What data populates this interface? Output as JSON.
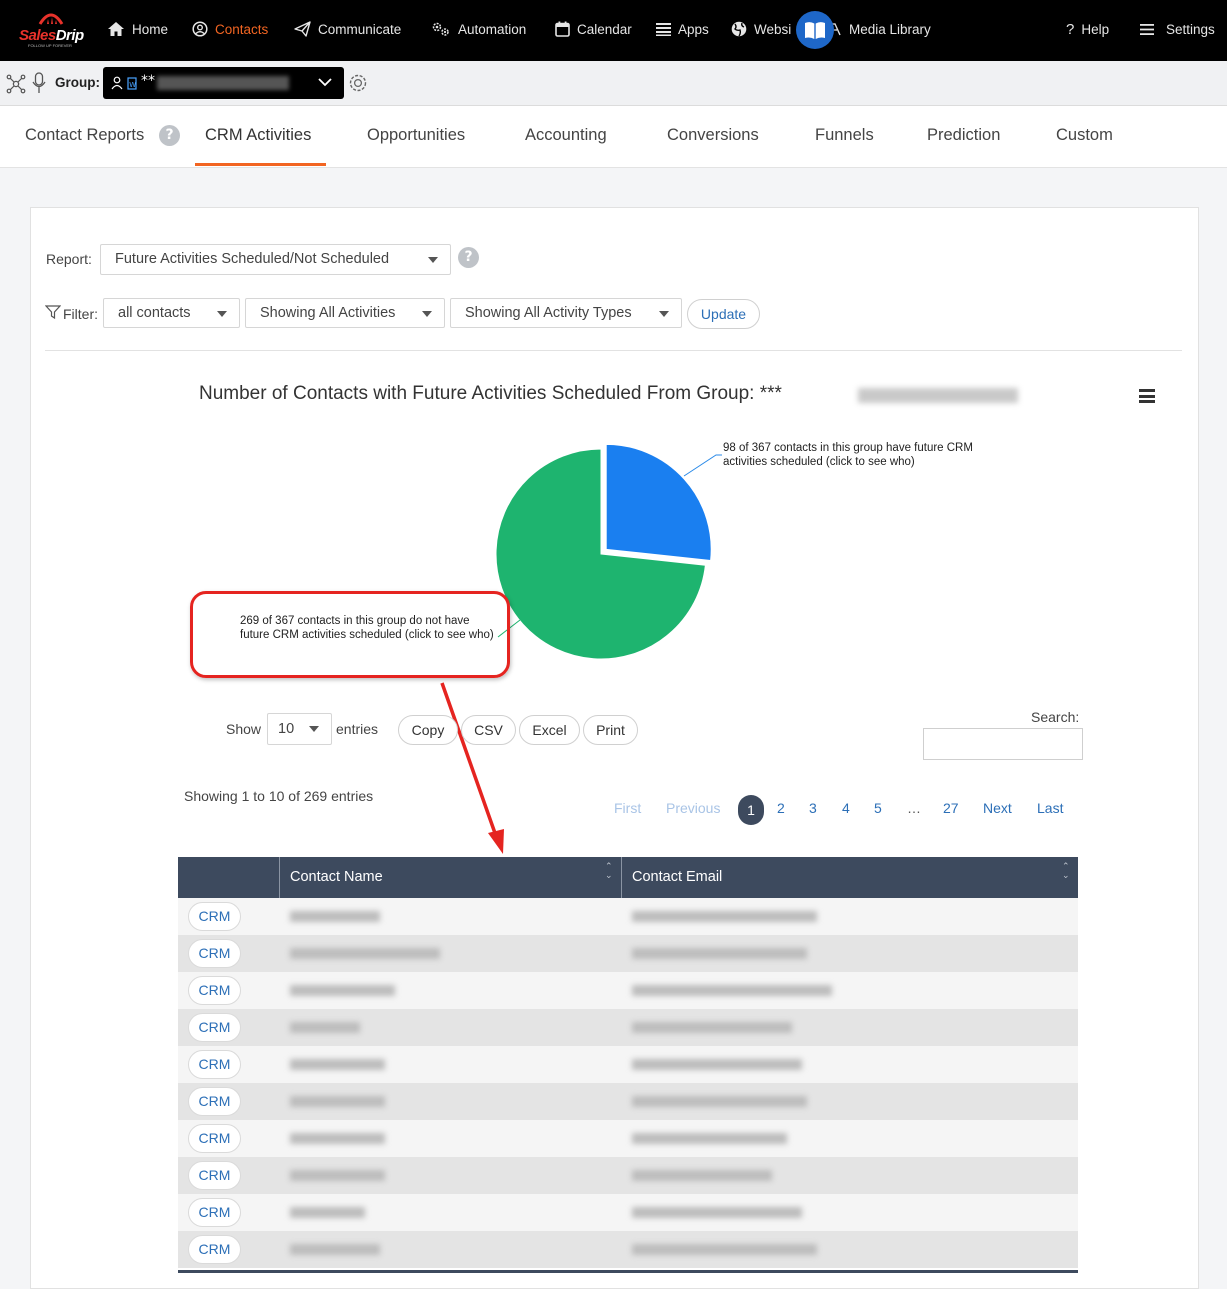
{
  "brand": {
    "name_red": "Sales",
    "name_white": "Drip",
    "tagline": "FOLLOW UP FOREVER"
  },
  "topnav": [
    {
      "label": "Home",
      "icon": "home-icon"
    },
    {
      "label": "Contacts",
      "icon": "user-circle-icon",
      "active": true
    },
    {
      "label": "Communicate",
      "icon": "paper-plane-icon"
    },
    {
      "label": "Automation",
      "icon": "gears-icon"
    },
    {
      "label": "Calendar",
      "icon": "calendar-icon"
    },
    {
      "label": "Apps",
      "icon": "list-icon"
    },
    {
      "label": "Websi",
      "icon": "globe-icon"
    },
    {
      "label": "Media Library",
      "icon": "media-icon"
    },
    {
      "label": "Help",
      "icon": "question-icon"
    },
    {
      "label": "Settings",
      "icon": "menu-icon"
    }
  ],
  "group": {
    "label": "Group:",
    "value_prefix": "**"
  },
  "tabs": [
    {
      "label": "Contact Reports"
    },
    {
      "label": "CRM Activities",
      "active": true
    },
    {
      "label": "Opportunities"
    },
    {
      "label": "Accounting"
    },
    {
      "label": "Conversions"
    },
    {
      "label": "Funnels"
    },
    {
      "label": "Prediction"
    },
    {
      "label": "Custom"
    }
  ],
  "report": {
    "label": "Report:",
    "value": "Future Activities Scheduled/Not Scheduled",
    "help": "?"
  },
  "filter": {
    "label": "Filter:",
    "contacts": "all contacts",
    "activities": "Showing All Activities",
    "types": "Showing All Activity Types",
    "update": "Update"
  },
  "chart": {
    "title": "Number of Contacts with Future Activities Scheduled From Group: ***",
    "label_scheduled": "98 of 367 contacts in this group have future CRM activities scheduled (click to see who)",
    "label_not_scheduled": "269 of 367 contacts in this group do not have future CRM activities scheduled (click to see who)"
  },
  "chart_data": {
    "type": "pie",
    "title": "Number of Contacts with Future Activities Scheduled From Group: ***",
    "slices": [
      {
        "label": "98 of 367 contacts in this group have future CRM activities scheduled (click to see who)",
        "value": 98,
        "color": "#1a7ff0"
      },
      {
        "label": "269 of 367 contacts in this group do not have future CRM activities scheduled (click to see who)",
        "value": 269,
        "color": "#1eb46f"
      }
    ]
  },
  "datatable": {
    "show": "Show",
    "entries_value": "10",
    "entries": "entries",
    "buttons": [
      "Copy",
      "CSV",
      "Excel",
      "Print"
    ],
    "search_label": "Search:",
    "info": "Showing 1 to 10 of 269 entries",
    "pagination": {
      "first": "First",
      "previous": "Previous",
      "pages": [
        "1",
        "2",
        "3",
        "4",
        "5",
        "…",
        "27"
      ],
      "next": "Next",
      "last": "Last"
    },
    "columns": [
      "",
      "Contact Name",
      "Contact Email"
    ],
    "row_button": "CRM"
  },
  "colors": {
    "accent": "#f26522",
    "header": "#3d4a5e",
    "link": "#2c6fb7",
    "callout": "#e52420"
  }
}
